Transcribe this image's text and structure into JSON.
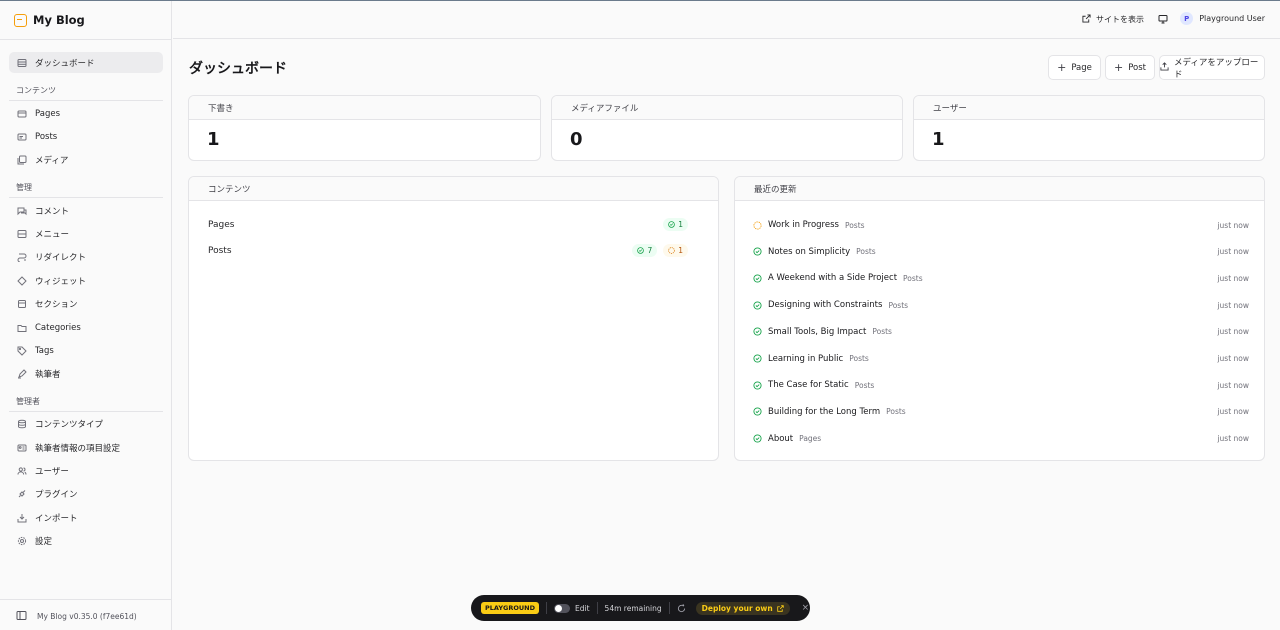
{
  "brand": {
    "name": "My Blog"
  },
  "sidebar": {
    "dashboard": "ダッシュボード",
    "sections": [
      {
        "label": "コンテンツ",
        "items": [
          "Pages",
          "Posts",
          "メディア"
        ]
      },
      {
        "label": "管理",
        "items": [
          "コメント",
          "メニュー",
          "リダイレクト",
          "ウィジェット",
          "セクション",
          "Categories",
          "Tags",
          "執筆者"
        ]
      },
      {
        "label": "管理者",
        "items": [
          "コンテンツタイプ",
          "執筆者情報の項目設定",
          "ユーザー",
          "プラグイン",
          "インポート",
          "設定"
        ]
      }
    ],
    "footer": "My Blog v0.35.0 (f7ee61d)"
  },
  "topbar": {
    "view_site": "サイトを表示",
    "user_initial": "P",
    "user_name": "Playground User"
  },
  "main": {
    "title": "ダッシュボード",
    "buttons": {
      "page": "Page",
      "post": "Post",
      "upload": "メディアをアップロード"
    },
    "stats": [
      {
        "label": "下書き",
        "value": "1"
      },
      {
        "label": "メディアファイル",
        "value": "0"
      },
      {
        "label": "ユーザー",
        "value": "1"
      }
    ],
    "content_panel": {
      "title": "コンテンツ",
      "rows": [
        {
          "label": "Pages",
          "published": "1",
          "drafts": null
        },
        {
          "label": "Posts",
          "published": "7",
          "drafts": "1"
        }
      ]
    },
    "recent_panel": {
      "title": "最近の更新",
      "items": [
        {
          "title": "Work in Progress",
          "type": "Posts",
          "time": "just now",
          "status": "draft"
        },
        {
          "title": "Notes on Simplicity",
          "type": "Posts",
          "time": "just now",
          "status": "published"
        },
        {
          "title": "A Weekend with a Side Project",
          "type": "Posts",
          "time": "just now",
          "status": "published"
        },
        {
          "title": "Designing with Constraints",
          "type": "Posts",
          "time": "just now",
          "status": "published"
        },
        {
          "title": "Small Tools, Big Impact",
          "type": "Posts",
          "time": "just now",
          "status": "published"
        },
        {
          "title": "Learning in Public",
          "type": "Posts",
          "time": "just now",
          "status": "published"
        },
        {
          "title": "The Case for Static",
          "type": "Posts",
          "time": "just now",
          "status": "published"
        },
        {
          "title": "Building for the Long Term",
          "type": "Posts",
          "time": "just now",
          "status": "published"
        },
        {
          "title": "About",
          "type": "Pages",
          "time": "just now",
          "status": "published"
        }
      ]
    }
  },
  "playground": {
    "badge": "PLAYGROUND",
    "edit": "Edit",
    "remaining": "54m remaining",
    "deploy": "Deploy your own",
    "close": "×"
  },
  "colors": {
    "accent": "#f59e0b",
    "published": "#16a34a",
    "draft": "#d97706"
  }
}
